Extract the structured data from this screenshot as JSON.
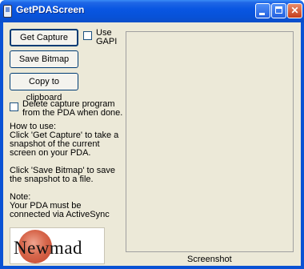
{
  "window": {
    "title": "GetPDAScreen",
    "controls": {
      "minimize": "minimize-icon",
      "maximize": "maximize-icon",
      "close": "close-icon"
    }
  },
  "buttons": {
    "get_capture": "Get Capture",
    "save_bitmap": "Save Bitmap",
    "copy_clipboard": "Copy to clipboard"
  },
  "options": {
    "use_gapi": {
      "label": "Use GAPI",
      "checked": false
    },
    "delete_program": {
      "label": "Delete capture program from the PDA when done.",
      "checked": false
    }
  },
  "instructions": "How to use:\nClick 'Get Capture' to take a snapshot of the current screen on your PDA.\n\nClick 'Save Bitmap' to save the snapshot to a file.\n\nNote:\nYour PDA must be connected via ActiveSync",
  "logo": {
    "text": "Newmad"
  },
  "preview": {
    "label": "Screenshot"
  },
  "colors": {
    "titlebar": "#0852d8",
    "client_bg": "#ece9d8",
    "button_border": "#003c74",
    "logo_accent": "#c4452c"
  }
}
